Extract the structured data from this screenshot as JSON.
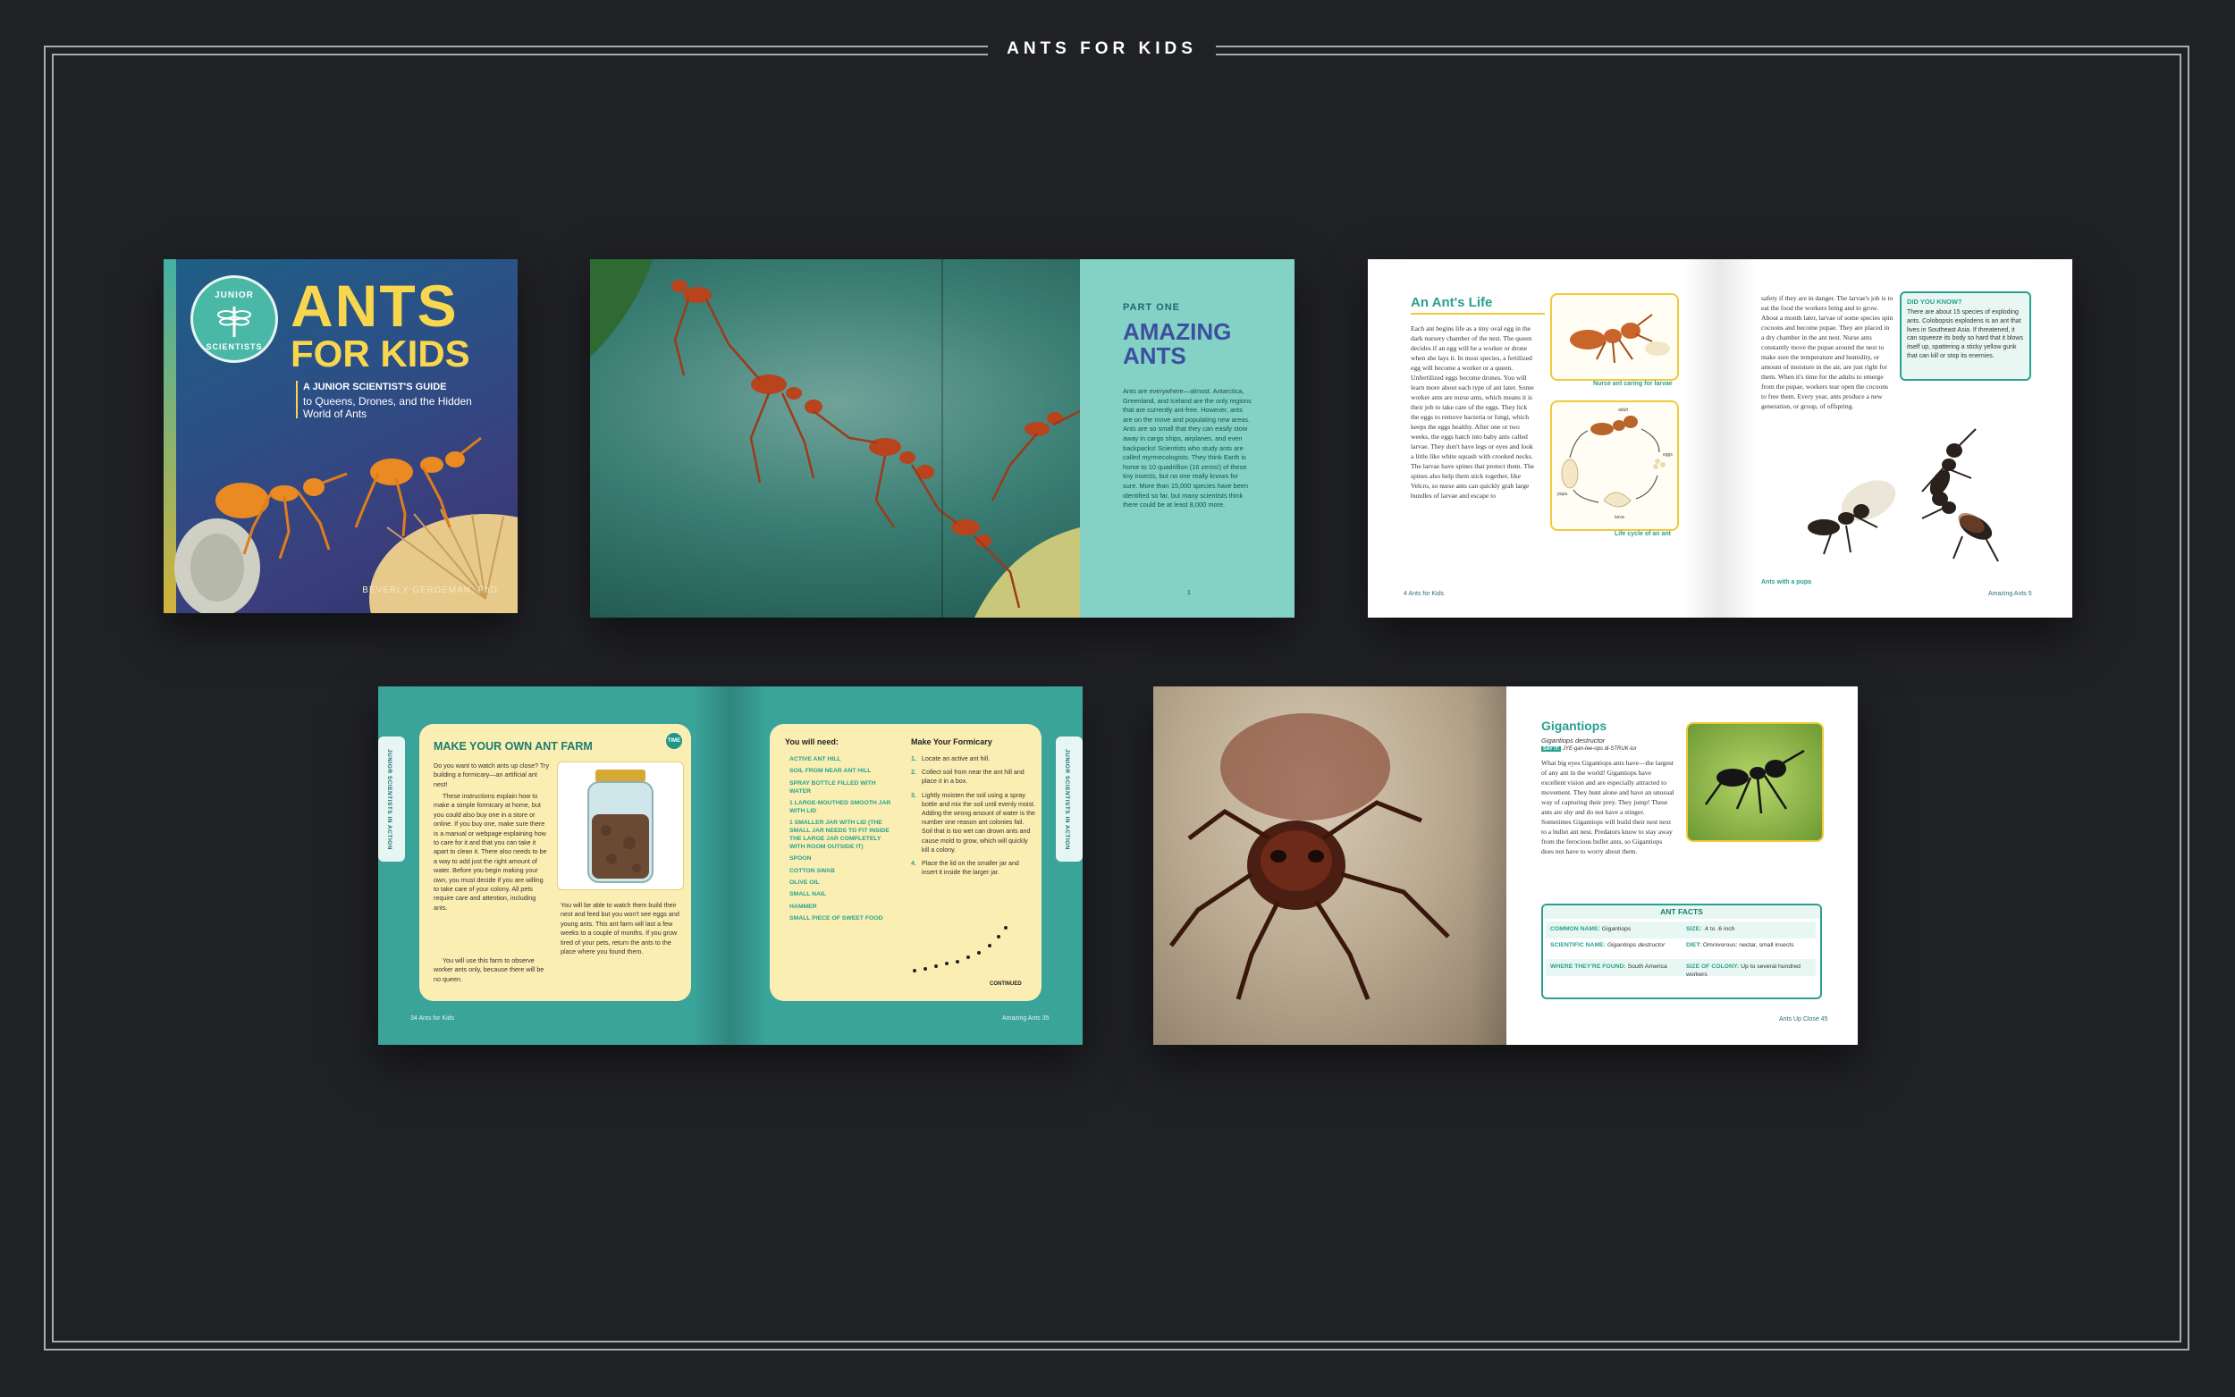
{
  "page": {
    "title": "ANTS FOR KIDS"
  },
  "cover": {
    "badge_top": "JUNIOR",
    "badge_bottom": "SCIENTISTS",
    "title_line1": "ANTS",
    "title_line2": "FOR KIDS",
    "subtitle_bold": "A JUNIOR SCIENTIST'S GUIDE",
    "subtitle": "to Queens, Drones, and the Hidden World of Ants",
    "author": "BEVERLY GERDEMAN, PhD"
  },
  "spread_amazing": {
    "part": "PART ONE",
    "title": "AMAZING ANTS",
    "body": "Ants are everywhere—almost. Antarctica, Greenland, and Iceland are the only regions that are currently ant-free. However, ants are on the move and populating new areas. Ants are so small that they can easily stow away in cargo ships, airplanes, and even backpacks! Scientists who study ants are called myrmecologists. They think Earth is home to 10 quadrillion (16 zeros!) of these tiny insects, but no one really knows for sure. More than 15,000 species have been identified so far, but many scientists think there could be at least 8,000 more.",
    "page_number": "1"
  },
  "spread_life": {
    "title": "An Ant's Life",
    "body_left": "Each ant begins life as a tiny oval egg in the dark nursery chamber of the nest. The queen decides if an egg will be a worker or drone when she lays it. In most species, a fertilized egg will become a worker or a queen. Unfertilized eggs become drones. You will learn more about each type of ant later. Some worker ants are nurse ants, which means it is their job to take care of the eggs. They lick the eggs to remove bacteria or fungi, which keeps the eggs healthy. After one or two weeks, the eggs hatch into baby ants called larvae. They don't have legs or eyes and look a little like white squash with crooked necks. The larvae have spines that protect them. The spines also help them stick together, like Velcro, so nurse ants can quickly grab large bundles of larvae and escape to",
    "caption_nurse": "Nurse ant caring for larvae",
    "caption_cycle": "Life cycle of an ant",
    "cycle_labels": [
      "adult",
      "eggs",
      "larva",
      "pupa"
    ],
    "body_right": "safety if they are in danger. The larvae's job is to eat the food the workers bring and to grow. About a month later, larvae of some species spin cocoons and become pupae. They are placed in a dry chamber in the ant nest. Nurse ants constantly move the pupae around the nest to make sure the temperature and humidity, or amount of moisture in the air, are just right for them. When it's time for the adults to emerge from the pupae, workers tear open the cocoons to free them. Every year, ants produce a new generation, or group, of offspring.",
    "dyk_title": "DID YOU KNOW?",
    "dyk_text": "There are about 15 species of exploding ants. Colobopsis explodens is an ant that lives in Southeast Asia. If threatened, it can squeeze its body so hard that it blows itself up, spattering a sticky yellow gunk that can kill or stop its enemies.",
    "caption_pupa": "Ants with a pupa",
    "footer_left": "4   Ants for Kids",
    "footer_right": "Amazing Ants   5"
  },
  "spread_farm": {
    "title": "MAKE YOUR OWN ANT FARM",
    "icon_text": "TIME",
    "intro_1": "Do you want to watch ants up close? Try building a formicary—an artificial ant nest!",
    "intro_2": "These instructions explain how to make a simple formicary at home, but you could also buy one in a store or online. If you buy one, make sure there is a manual or webpage explaining how to care for it and that you can take it apart to clean it. There also needs to be a way to add just the right amount of water. Before you begin making your own, you must decide if you are willing to take care of your colony. All pets require care and attention, including ants.",
    "intro_3": "You will use this farm to observe worker ants only, because there will be no queen.",
    "jar_text": "You will be able to watch them build their nest and feed but you won't see eggs and young ants. This ant farm will last a few weeks to a couple of months. If you grow tired of your pets, return the ants to the place where you found them.",
    "side_tab": "JUNIOR SCIENTISTS IN ACTION",
    "need_title": "You will need:",
    "need_items": [
      "ACTIVE ANT HILL",
      "SOIL FROM NEAR ANT HILL",
      "SPRAY BOTTLE FILLED WITH WATER",
      "1 LARGE-MOUTHED SMOOTH JAR WITH LID",
      "1 SMALLER JAR WITH LID (THE SMALL JAR NEEDS TO FIT INSIDE THE LARGE JAR COMPLETELY WITH ROOM OUTSIDE IT)",
      "SPOON",
      "COTTON SWAB",
      "OLIVE OIL",
      "SMALL NAIL",
      "HAMMER",
      "SMALL PIECE OF SWEET FOOD"
    ],
    "steps_title": "Make Your Formicary",
    "steps": [
      {
        "n": "1.",
        "t": "Locate an active ant hill."
      },
      {
        "n": "2.",
        "t": "Collect soil from near the ant hill and place it in a box."
      },
      {
        "n": "3.",
        "t": "Lightly moisten the soil using a spray bottle and mix the soil until evenly moist. Adding the wrong amount of water is the number one reason ant colonies fail. Soil that is too wet can drown ants and cause mold to grow, which will quickly kill a colony."
      },
      {
        "n": "4.",
        "t": "Place the lid on the smaller jar and insert it inside the larger jar."
      }
    ],
    "continued": "CONTINUED",
    "footer_left": "34   Ants for Kids",
    "footer_right": "Amazing Ants   35"
  },
  "spread_gig": {
    "title": "Gigantiops",
    "scientific": "Gigantiops destructor",
    "say_label": "SAY IT:",
    "say": "JYE-gan-tee-ops di-STRUK-tur",
    "body": "What big eyes Gigantiops ants have—the largest of any ant in the world! Gigantiops have excellent vision and are especially attracted to movement. They hunt alone and have an unusual way of capturing their prey. They jump! These ants are shy and do not have a stinger. Sometimes Gigantiops will build their nest next to a bullet ant nest. Predators know to stay away from the ferocious bullet ants, so Gigantiops does not have to worry about them.",
    "facts_title": "ANT FACTS",
    "facts": [
      {
        "label": "COMMON NAME:",
        "value": "Gigantiops"
      },
      {
        "label": "SIZE:",
        "value": ".4 to .6 inch"
      },
      {
        "label": "SCIENTIFIC NAME:",
        "value": "Gigantiops destructor"
      },
      {
        "label": "DIET:",
        "value": "Omnivorous: nectar, small insects"
      },
      {
        "label": "WHERE THEY'RE FOUND:",
        "value": "South America"
      },
      {
        "label": "SIZE OF COLONY:",
        "value": "Up to several hundred workers"
      }
    ],
    "footer_right": "Ants Up Close   45"
  },
  "colors": {
    "background": "#202125",
    "teal": "#2aa08f",
    "yellow": "#f8d64d",
    "navy": "#3d4f9e"
  }
}
